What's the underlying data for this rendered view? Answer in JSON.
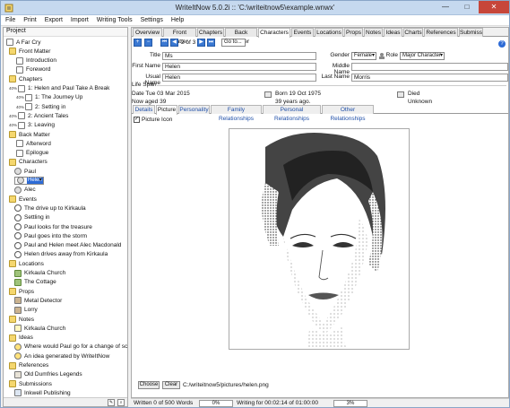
{
  "window": {
    "title": "WriteItNow 5.0.2i :: 'C:\\writeitnow5\\example.wnwx'",
    "minimize_label": "—",
    "maximize_label": "□",
    "close_label": "✕"
  },
  "menu": [
    "File",
    "Print",
    "Export",
    "Import",
    "Writing Tools",
    "Settings",
    "Help"
  ],
  "project_panel": {
    "header": "Project",
    "tree": [
      {
        "label": "A Far Cry",
        "icon": "book-icon"
      },
      {
        "label": "Front Matter",
        "icon": "folder-icon"
      },
      {
        "label": "Introduction",
        "icon": "document-icon"
      },
      {
        "label": "Foreword",
        "icon": "document-icon"
      },
      {
        "label": "Chapters",
        "icon": "folder-icon"
      },
      {
        "label": "1: Helen and Paul Take A Break",
        "icon": "chapter-icon",
        "progress": "40%"
      },
      {
        "label": "1: The Journey Up",
        "icon": "scene-icon",
        "progress": "40%"
      },
      {
        "label": "2: Setting in",
        "icon": "scene-icon",
        "progress": "40%"
      },
      {
        "label": "2: Ancient Tales",
        "icon": "chapter-icon",
        "progress": "40%"
      },
      {
        "label": "3: Leaving",
        "icon": "chapter-icon",
        "progress": "40%"
      },
      {
        "label": "Back Matter",
        "icon": "folder-icon"
      },
      {
        "label": "Afterword",
        "icon": "document-icon"
      },
      {
        "label": "Epilogue",
        "icon": "document-icon"
      },
      {
        "label": "Characters",
        "icon": "folder-icon"
      },
      {
        "label": "Paul",
        "icon": "person-icon"
      },
      {
        "label": "Helen",
        "icon": "person-icon",
        "selected": true
      },
      {
        "label": "Alec",
        "icon": "person-icon"
      },
      {
        "label": "Events",
        "icon": "folder-icon"
      },
      {
        "label": "The drive up to Kirkaula",
        "icon": "clock-icon"
      },
      {
        "label": "Settling in",
        "icon": "clock-icon"
      },
      {
        "label": "Paul looks for the treasure",
        "icon": "clock-icon"
      },
      {
        "label": "Paul goes into the storm",
        "icon": "clock-icon"
      },
      {
        "label": "Paul and Helen meet Alec Macdonald",
        "icon": "clock-icon"
      },
      {
        "label": "Helen drives away from Kirkaula",
        "icon": "clock-icon"
      },
      {
        "label": "Locations",
        "icon": "folder-icon"
      },
      {
        "label": "Kirkaula Church",
        "icon": "location-icon"
      },
      {
        "label": "The Cottage",
        "icon": "location-icon"
      },
      {
        "label": "Props",
        "icon": "folder-icon"
      },
      {
        "label": "Metal Detector",
        "icon": "prop-icon"
      },
      {
        "label": "Lorry",
        "icon": "prop-icon"
      },
      {
        "label": "Notes",
        "icon": "folder-icon"
      },
      {
        "label": "Kirkaula Church",
        "icon": "note-icon"
      },
      {
        "label": "Ideas",
        "icon": "folder-icon"
      },
      {
        "label": "Where would Paul go for a change of scene?",
        "icon": "idea-icon"
      },
      {
        "label": "An idea generated by WriteItNow",
        "icon": "idea-icon"
      },
      {
        "label": "References",
        "icon": "folder-icon"
      },
      {
        "label": "Old Dumfries Legends",
        "icon": "reference-icon"
      },
      {
        "label": "Submissions",
        "icon": "folder-icon"
      },
      {
        "label": "Inkwell Publishing",
        "icon": "submission-icon"
      }
    ]
  },
  "tabs": [
    "Overview",
    "Front Matter",
    "Chapters",
    "Back Matter",
    "Characters",
    "Events",
    "Locations",
    "Props",
    "Notes",
    "Ideas",
    "Charts",
    "References",
    "Submiss"
  ],
  "active_tab": "Characters",
  "nav": {
    "counter": "2 of 3",
    "goto_label": "Go to..."
  },
  "form": {
    "title_label": "Title",
    "title_value": "Ms",
    "gender_label": "Gender",
    "gender_value": "Female",
    "role_label": "Role",
    "role_value": "Major Character",
    "first_name_label": "First Name",
    "first_name_value": "Helen",
    "middle_name_label": "Middle Name",
    "middle_name_value": "",
    "usual_name_label": "Usual Name",
    "usual_name_value": "Helen",
    "last_name_label": "Last Name",
    "last_name_value": "Morris"
  },
  "lifespan": {
    "header": "Life Span",
    "date_line": "Date Tue 03 Mar 2015",
    "now_aged": "Now aged 39",
    "born": "Born 19 Oct 1975",
    "years_ago": "39 years ago.",
    "died": "Died",
    "died_value": "Unknown"
  },
  "subtabs": [
    "Details",
    "Picture",
    "Personality",
    "Family Relationships",
    "Personal Relationships",
    "Other Relationships"
  ],
  "active_subtab": "Picture",
  "picture": {
    "checkbox_label": "Picture Icon",
    "choose_label": "Choose",
    "clear_label": "Clear",
    "path": "C:/writeitnow5/pictures/helen.png"
  },
  "status": {
    "words": "Written 0 of 500 Words",
    "words_pct": "0%",
    "time": "Writing for 00:02:14 of 01:00:00",
    "time_pct": "3%"
  },
  "colors": {
    "accent": "#2d6bd6",
    "titlebar": "#c6d9ef",
    "close": "#c7463a"
  }
}
